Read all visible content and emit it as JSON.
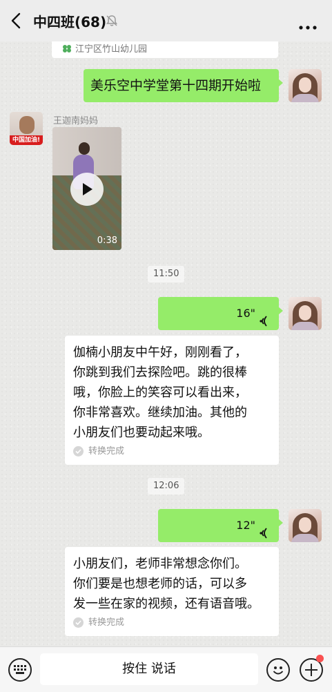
{
  "header": {
    "title": "中四班(68)",
    "back_icon": "chevron-left-icon",
    "mute_icon": "bell-off-icon",
    "more_icon": "more-dots-icon"
  },
  "chat": {
    "location_card_text": "江宁区竹山幼儿园",
    "messages": [
      {
        "type": "text",
        "direction": "sent",
        "text": "美乐空中学堂第十四期开始啦"
      },
      {
        "type": "video",
        "direction": "received",
        "sender": "王迦南妈妈",
        "duration": "0:38"
      },
      {
        "type": "time",
        "text": "11:50"
      },
      {
        "type": "voice",
        "direction": "sent",
        "duration": "16\""
      },
      {
        "type": "transcript",
        "lines": [
          "伽楠小朋友中午好，刚刚看了，",
          "你跳到我们去探险吧。跳的很棒",
          "哦，你脸上的笑容可以看出来，",
          "你非常喜欢。继续加油。其他的",
          "小朋友们也要动起来哦。"
        ],
        "status": "转换完成"
      },
      {
        "type": "time",
        "text": "12:06"
      },
      {
        "type": "voice",
        "direction": "sent",
        "duration": "12\""
      },
      {
        "type": "transcript",
        "lines": [
          "小朋友们，老师非常想念你们。",
          "你们要是也想老师的话，可以多",
          "发一些在家的视频，还有语音哦。"
        ],
        "status": "转换完成"
      }
    ],
    "avatar_badge_text": "中国加油!"
  },
  "input_bar": {
    "hold_to_talk": "按住 说话",
    "keyboard_icon": "keyboard-icon",
    "emoji_icon": "smile-icon",
    "plus_icon": "plus-circle-icon"
  },
  "colors": {
    "sent_bubble": "#95ec69",
    "received_bubble": "#ffffff",
    "badge_red": "#fa5151"
  }
}
